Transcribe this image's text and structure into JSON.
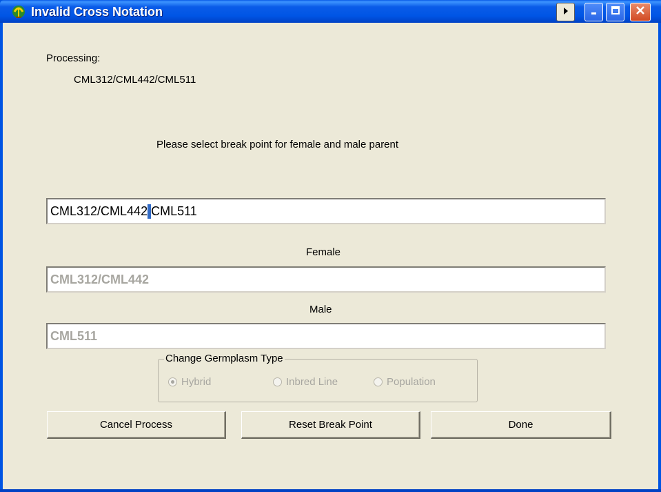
{
  "window": {
    "title": "Invalid Cross Notation",
    "colors": {
      "titlebar": "#0055e5",
      "client": "#ece9d8",
      "close": "#d24a23"
    },
    "icons": [
      "app-icon",
      "arrow-right-icon",
      "minimize-icon",
      "maximize-icon",
      "close-icon"
    ]
  },
  "processing": {
    "label": "Processing:",
    "value": "CML312/CML442/CML511"
  },
  "instruction": "Please select break point for female and male parent",
  "cross": {
    "before": "CML312/CML442",
    "selected": "/",
    "after": "CML511"
  },
  "female": {
    "label": "Female",
    "value": "CML312/CML442"
  },
  "male": {
    "label": "Male",
    "value": "CML511"
  },
  "germplasm": {
    "legend": "Change Germplasm Type",
    "options": [
      {
        "label": "Hybrid",
        "selected": true
      },
      {
        "label": "Inbred Line",
        "selected": false
      },
      {
        "label": "Population",
        "selected": false
      }
    ]
  },
  "buttons": {
    "cancel": "Cancel Process",
    "reset": "Reset Break Point",
    "done": "Done"
  }
}
